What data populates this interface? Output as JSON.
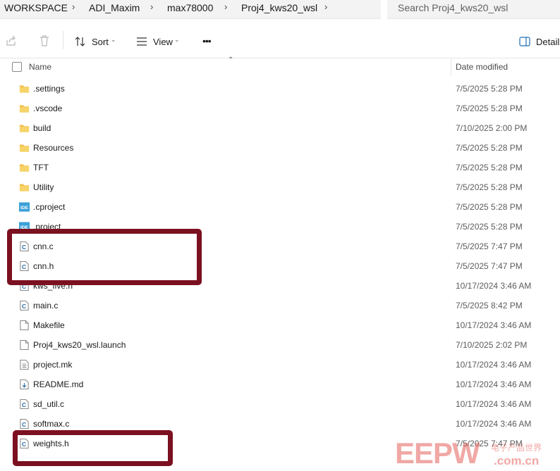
{
  "address": {
    "crumbs": [
      "WORKSPACE",
      "ADI_Maxim",
      "max78000",
      "Proj4_kws20_wsl"
    ]
  },
  "search": {
    "placeholder": "Search Proj4_kws20_wsl"
  },
  "toolbar": {
    "share_icon": "share-icon",
    "delete_icon": "trash-icon",
    "sort_label": "Sort",
    "view_label": "View",
    "more_label": "•••",
    "details_label": "Details"
  },
  "columns": {
    "name": "Name",
    "date_modified": "Date modified"
  },
  "files": [
    {
      "name": ".settings",
      "date": "7/5/2025 5:28 PM",
      "type": "folder"
    },
    {
      "name": ".vscode",
      "date": "7/5/2025 5:28 PM",
      "type": "folder"
    },
    {
      "name": "build",
      "date": "7/10/2025 2:00 PM",
      "type": "folder"
    },
    {
      "name": "Resources",
      "date": "7/5/2025 5:28 PM",
      "type": "folder"
    },
    {
      "name": "TFT",
      "date": "7/5/2025 5:28 PM",
      "type": "folder"
    },
    {
      "name": "Utility",
      "date": "7/5/2025 5:28 PM",
      "type": "folder"
    },
    {
      "name": ".cproject",
      "date": "7/5/2025 5:28 PM",
      "type": "ide"
    },
    {
      "name": ".project",
      "date": "7/5/2025 5:28 PM",
      "type": "ide"
    },
    {
      "name": "cnn.c",
      "date": "7/5/2025 7:47 PM",
      "type": "c"
    },
    {
      "name": "cnn.h",
      "date": "7/5/2025 7:47 PM",
      "type": "c"
    },
    {
      "name": "kws_five.h",
      "date": "10/17/2024 3:46 AM",
      "type": "c"
    },
    {
      "name": "main.c",
      "date": "7/5/2025 8:42 PM",
      "type": "c"
    },
    {
      "name": "Makefile",
      "date": "10/17/2024 3:46 AM",
      "type": "blank"
    },
    {
      "name": "Proj4_kws20_wsl.launch",
      "date": "7/10/2025 2:02 PM",
      "type": "blank"
    },
    {
      "name": "project.mk",
      "date": "10/17/2024 3:46 AM",
      "type": "text"
    },
    {
      "name": "README.md",
      "date": "10/17/2024 3:46 AM",
      "type": "md"
    },
    {
      "name": "sd_util.c",
      "date": "10/17/2024 3:46 AM",
      "type": "c"
    },
    {
      "name": "softmax.c",
      "date": "10/17/2024 3:46 AM",
      "type": "c"
    },
    {
      "name": "weights.h",
      "date": "7/5/2025 7:47 PM",
      "type": "c"
    }
  ],
  "colors": {
    "highlight": "#7b1020",
    "folder": "#f2c14e",
    "ide": "#3aa0d8",
    "watermark": "#e4625c"
  },
  "watermark": {
    "logo": "EEPW",
    "domain": "com.cn",
    "chinese": "电子产品世界"
  }
}
